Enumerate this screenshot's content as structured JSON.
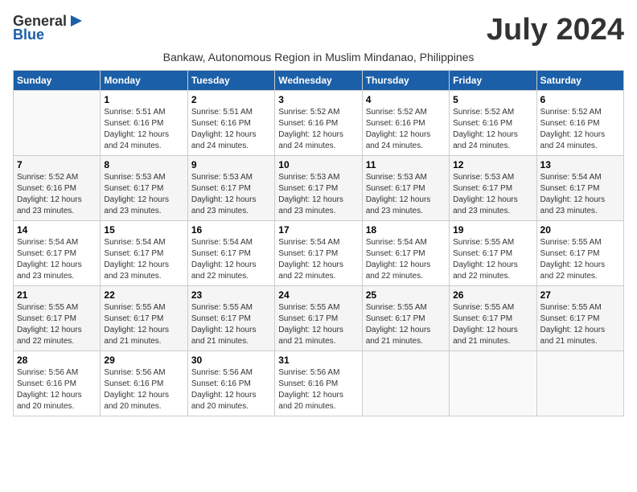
{
  "logo": {
    "general": "General",
    "blue": "Blue"
  },
  "title": "July 2024",
  "subtitle": "Bankaw, Autonomous Region in Muslim Mindanao, Philippines",
  "days_header": [
    "Sunday",
    "Monday",
    "Tuesday",
    "Wednesday",
    "Thursday",
    "Friday",
    "Saturday"
  ],
  "weeks": [
    [
      {
        "day": "",
        "info": ""
      },
      {
        "day": "1",
        "info": "Sunrise: 5:51 AM\nSunset: 6:16 PM\nDaylight: 12 hours\nand 24 minutes."
      },
      {
        "day": "2",
        "info": "Sunrise: 5:51 AM\nSunset: 6:16 PM\nDaylight: 12 hours\nand 24 minutes."
      },
      {
        "day": "3",
        "info": "Sunrise: 5:52 AM\nSunset: 6:16 PM\nDaylight: 12 hours\nand 24 minutes."
      },
      {
        "day": "4",
        "info": "Sunrise: 5:52 AM\nSunset: 6:16 PM\nDaylight: 12 hours\nand 24 minutes."
      },
      {
        "day": "5",
        "info": "Sunrise: 5:52 AM\nSunset: 6:16 PM\nDaylight: 12 hours\nand 24 minutes."
      },
      {
        "day": "6",
        "info": "Sunrise: 5:52 AM\nSunset: 6:16 PM\nDaylight: 12 hours\nand 24 minutes."
      }
    ],
    [
      {
        "day": "7",
        "info": "Sunrise: 5:52 AM\nSunset: 6:16 PM\nDaylight: 12 hours\nand 23 minutes."
      },
      {
        "day": "8",
        "info": "Sunrise: 5:53 AM\nSunset: 6:17 PM\nDaylight: 12 hours\nand 23 minutes."
      },
      {
        "day": "9",
        "info": "Sunrise: 5:53 AM\nSunset: 6:17 PM\nDaylight: 12 hours\nand 23 minutes."
      },
      {
        "day": "10",
        "info": "Sunrise: 5:53 AM\nSunset: 6:17 PM\nDaylight: 12 hours\nand 23 minutes."
      },
      {
        "day": "11",
        "info": "Sunrise: 5:53 AM\nSunset: 6:17 PM\nDaylight: 12 hours\nand 23 minutes."
      },
      {
        "day": "12",
        "info": "Sunrise: 5:53 AM\nSunset: 6:17 PM\nDaylight: 12 hours\nand 23 minutes."
      },
      {
        "day": "13",
        "info": "Sunrise: 5:54 AM\nSunset: 6:17 PM\nDaylight: 12 hours\nand 23 minutes."
      }
    ],
    [
      {
        "day": "14",
        "info": "Sunrise: 5:54 AM\nSunset: 6:17 PM\nDaylight: 12 hours\nand 23 minutes."
      },
      {
        "day": "15",
        "info": "Sunrise: 5:54 AM\nSunset: 6:17 PM\nDaylight: 12 hours\nand 23 minutes."
      },
      {
        "day": "16",
        "info": "Sunrise: 5:54 AM\nSunset: 6:17 PM\nDaylight: 12 hours\nand 22 minutes."
      },
      {
        "day": "17",
        "info": "Sunrise: 5:54 AM\nSunset: 6:17 PM\nDaylight: 12 hours\nand 22 minutes."
      },
      {
        "day": "18",
        "info": "Sunrise: 5:54 AM\nSunset: 6:17 PM\nDaylight: 12 hours\nand 22 minutes."
      },
      {
        "day": "19",
        "info": "Sunrise: 5:55 AM\nSunset: 6:17 PM\nDaylight: 12 hours\nand 22 minutes."
      },
      {
        "day": "20",
        "info": "Sunrise: 5:55 AM\nSunset: 6:17 PM\nDaylight: 12 hours\nand 22 minutes."
      }
    ],
    [
      {
        "day": "21",
        "info": "Sunrise: 5:55 AM\nSunset: 6:17 PM\nDaylight: 12 hours\nand 22 minutes."
      },
      {
        "day": "22",
        "info": "Sunrise: 5:55 AM\nSunset: 6:17 PM\nDaylight: 12 hours\nand 21 minutes."
      },
      {
        "day": "23",
        "info": "Sunrise: 5:55 AM\nSunset: 6:17 PM\nDaylight: 12 hours\nand 21 minutes."
      },
      {
        "day": "24",
        "info": "Sunrise: 5:55 AM\nSunset: 6:17 PM\nDaylight: 12 hours\nand 21 minutes."
      },
      {
        "day": "25",
        "info": "Sunrise: 5:55 AM\nSunset: 6:17 PM\nDaylight: 12 hours\nand 21 minutes."
      },
      {
        "day": "26",
        "info": "Sunrise: 5:55 AM\nSunset: 6:17 PM\nDaylight: 12 hours\nand 21 minutes."
      },
      {
        "day": "27",
        "info": "Sunrise: 5:55 AM\nSunset: 6:17 PM\nDaylight: 12 hours\nand 21 minutes."
      }
    ],
    [
      {
        "day": "28",
        "info": "Sunrise: 5:56 AM\nSunset: 6:16 PM\nDaylight: 12 hours\nand 20 minutes."
      },
      {
        "day": "29",
        "info": "Sunrise: 5:56 AM\nSunset: 6:16 PM\nDaylight: 12 hours\nand 20 minutes."
      },
      {
        "day": "30",
        "info": "Sunrise: 5:56 AM\nSunset: 6:16 PM\nDaylight: 12 hours\nand 20 minutes."
      },
      {
        "day": "31",
        "info": "Sunrise: 5:56 AM\nSunset: 6:16 PM\nDaylight: 12 hours\nand 20 minutes."
      },
      {
        "day": "",
        "info": ""
      },
      {
        "day": "",
        "info": ""
      },
      {
        "day": "",
        "info": ""
      }
    ]
  ]
}
